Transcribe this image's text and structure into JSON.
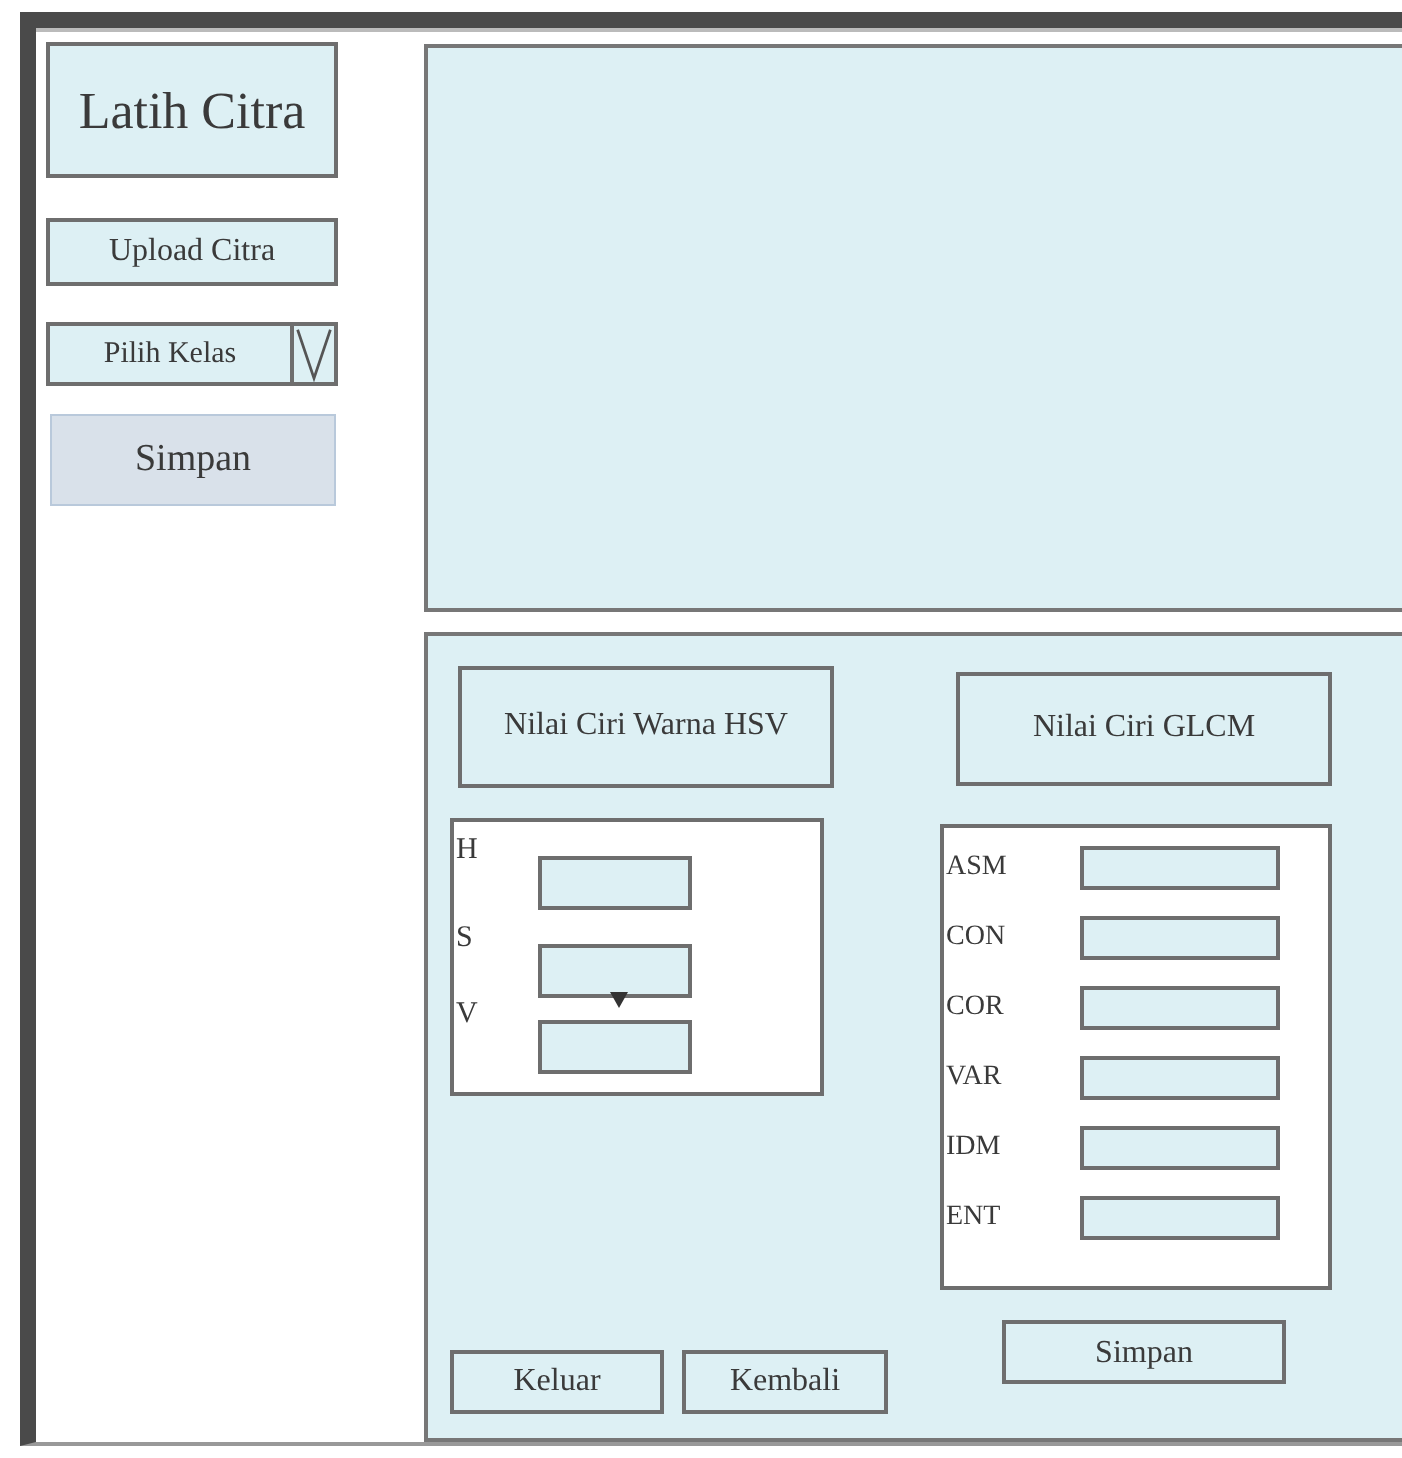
{
  "sidebar": {
    "title": "Latih Citra",
    "upload_button": "Upload Citra",
    "class_dropdown": {
      "label": "Pilih Kelas"
    },
    "save_button": "Simpan"
  },
  "features": {
    "hsv": {
      "heading": "Nilai Ciri Warna HSV",
      "fields": [
        {
          "label": "H"
        },
        {
          "label": "S"
        },
        {
          "label": "V"
        }
      ]
    },
    "glcm": {
      "heading": "Nilai Ciri GLCM",
      "fields": [
        {
          "label": "ASM"
        },
        {
          "label": "CON"
        },
        {
          "label": "COR"
        },
        {
          "label": "VAR"
        },
        {
          "label": "IDM"
        },
        {
          "label": "ENT"
        }
      ],
      "save_button": "Simpan"
    },
    "buttons": [
      "Keluar",
      "Kembali"
    ]
  }
}
